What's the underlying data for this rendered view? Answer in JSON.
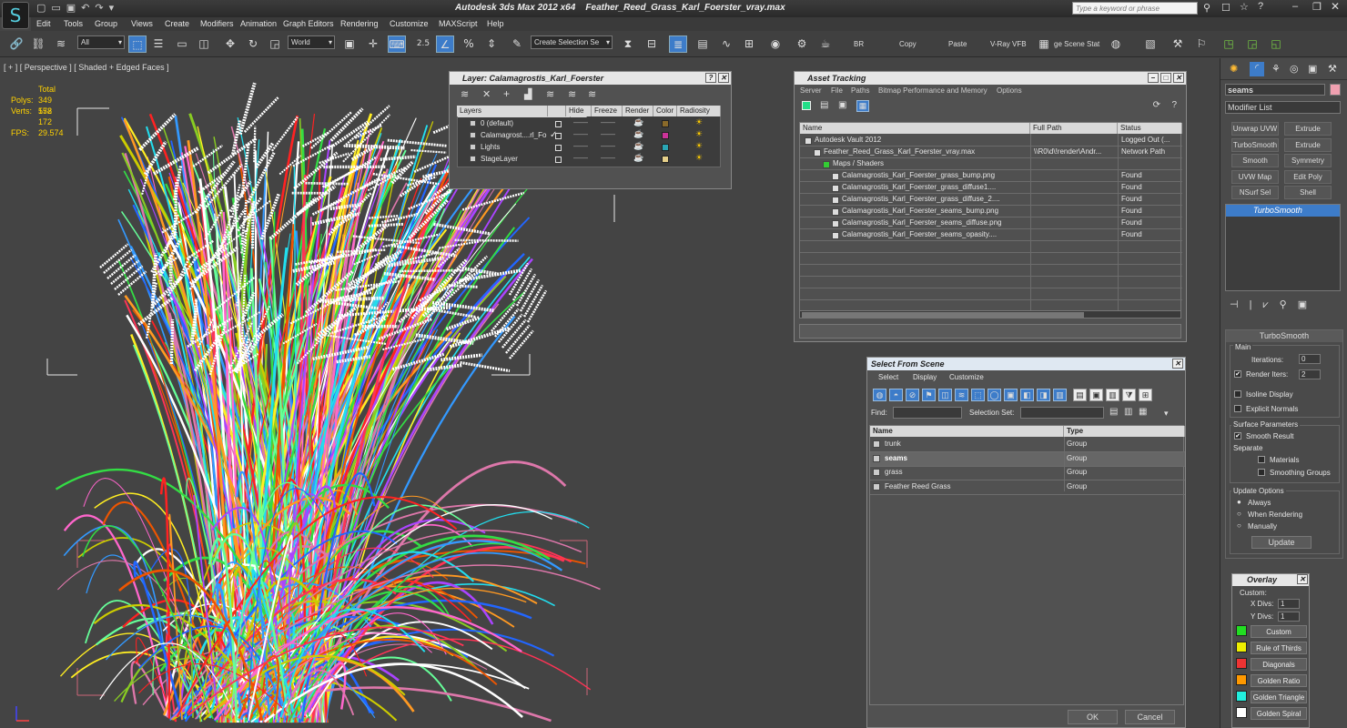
{
  "title": {
    "app": "Autodesk 3ds Max  2012 x64",
    "file": "Feather_Reed_Grass_Karl_Foerster_vray.max"
  },
  "menu": [
    "Edit",
    "Tools",
    "Group",
    "Views",
    "Create",
    "Modifiers",
    "Animation",
    "Graph Editors",
    "Rendering",
    "Customize",
    "MAXScript",
    "Help"
  ],
  "search": {
    "placeholder": "Type a keyword or phrase"
  },
  "toolbar": {
    "filter": "All",
    "coord": "World",
    "snap_angle": "2.5",
    "selection_set": "Create Selection Se",
    "labels": [
      "BR",
      "Copy",
      "Paste",
      "V-Ray VFB",
      "ge Scene Stat"
    ]
  },
  "viewport": {
    "label": "[ + ] [ Perspective ] [ Shaded + Edged Faces ]",
    "stats": {
      "total_label": "Total",
      "polys_label": "Polys:",
      "polys": "349 552",
      "verts_label": "Verts:",
      "verts": "178 172",
      "fps_label": "FPS:",
      "fps": "29.574"
    }
  },
  "layer_window": {
    "title": "Layer: Calamagrostis_Karl_Foerster",
    "columns": [
      "Layers",
      "Hide",
      "Freeze",
      "Render",
      "Color",
      "Radiosity"
    ],
    "rows": [
      {
        "name": "0 (default)",
        "color": "#8a6a2a",
        "current": false
      },
      {
        "name": "Calamagrost....rl_Fo",
        "color": "#cc3399",
        "current": true
      },
      {
        "name": "Lights",
        "color": "#2aa6b4",
        "current": false
      },
      {
        "name": "StageLayer",
        "color": "#e6d08a",
        "current": false
      }
    ]
  },
  "asset_tracking": {
    "title": "Asset Tracking",
    "menu": [
      "Server",
      "File",
      "Paths",
      "Bitmap Performance and Memory",
      "Options"
    ],
    "columns": [
      "Name",
      "Full Path",
      "Status"
    ],
    "rows": [
      {
        "name": "Autodesk Vault 2012",
        "path": "",
        "status": "Logged Out (...",
        "indent": 1
      },
      {
        "name": "Feather_Reed_Grass_Karl_Foerster_vray.max",
        "path": "\\\\R0\\d\\!render\\Andr...",
        "status": "Network Path",
        "indent": 2
      },
      {
        "name": "Maps / Shaders",
        "path": "",
        "status": "",
        "indent": 3
      },
      {
        "name": "Calamagrostis_Karl_Foerster_grass_bump.png",
        "path": "",
        "status": "Found",
        "indent": 4
      },
      {
        "name": "Calamagrostis_Karl_Foerster_grass_diffuse1....",
        "path": "",
        "status": "Found",
        "indent": 4
      },
      {
        "name": "Calamagrostis_Karl_Foerster_grass_diffuse_2....",
        "path": "",
        "status": "Found",
        "indent": 4
      },
      {
        "name": "Calamagrostis_Karl_Foerster_seams_bump.png",
        "path": "",
        "status": "Found",
        "indent": 4
      },
      {
        "name": "Calamagrostis_Karl_Foerster_seams_diffuse.png",
        "path": "",
        "status": "Found",
        "indent": 4
      },
      {
        "name": "Calamagrostis_Karl_Foerster_seams_opasity....",
        "path": "",
        "status": "Found",
        "indent": 4
      }
    ]
  },
  "select_from_scene": {
    "title": "Select From Scene",
    "menu": [
      "Select",
      "Display",
      "Customize"
    ],
    "find_label": "Find:",
    "selset_label": "Selection Set:",
    "columns": [
      "Name",
      "Type"
    ],
    "rows": [
      {
        "name": "trunk",
        "type": "Group",
        "selected": false
      },
      {
        "name": "seams",
        "type": "Group",
        "selected": true
      },
      {
        "name": "grass",
        "type": "Group",
        "selected": false
      },
      {
        "name": "Feather Reed Grass",
        "type": "Group",
        "selected": false
      }
    ],
    "ok": "OK",
    "cancel": "Cancel"
  },
  "command_panel": {
    "object_name": "seams",
    "modifier_list": "Modifier List",
    "buttons": [
      "Unwrap UVW",
      "Extrude",
      "TurboSmooth",
      "Extrude",
      "Smooth",
      "Symmetry",
      "UVW Map",
      "Edit Poly",
      "NSurf Sel",
      "Shell"
    ],
    "stack_item": "TurboSmooth",
    "rollout_title": "TurboSmooth",
    "main_label": "Main",
    "iterations_label": "Iterations:",
    "iterations": "0",
    "render_iters_label": "Render Iters:",
    "render_iters": "2",
    "isoline": "Isoline Display",
    "explicit_normals": "Explicit Normals",
    "surface_params": "Surface Parameters",
    "smooth_result": "Smooth Result",
    "separate": "Separate",
    "materials": "Materials",
    "smoothing_groups": "Smoothing Groups",
    "update_options": "Update Options",
    "always": "Always",
    "when_rendering": "When Rendering",
    "manually": "Manually",
    "update": "Update"
  },
  "overlay": {
    "title": "Overlay",
    "custom_label": "Custom:",
    "xdivs_label": "X Divs:",
    "xdivs": "1",
    "ydivs_label": "Y Divs:",
    "ydivs": "1",
    "items": [
      {
        "label": "Custom",
        "color": "#22dd22"
      },
      {
        "label": "Rule of Thirds",
        "color": "#eeee00"
      },
      {
        "label": "Diagonals",
        "color": "#ee3333"
      },
      {
        "label": "Golden Ratio",
        "color": "#ff9900"
      },
      {
        "label": "Golden Triangle",
        "color": "#22eedd"
      },
      {
        "label": "Golden Spiral",
        "color": "#ffffff"
      }
    ]
  }
}
